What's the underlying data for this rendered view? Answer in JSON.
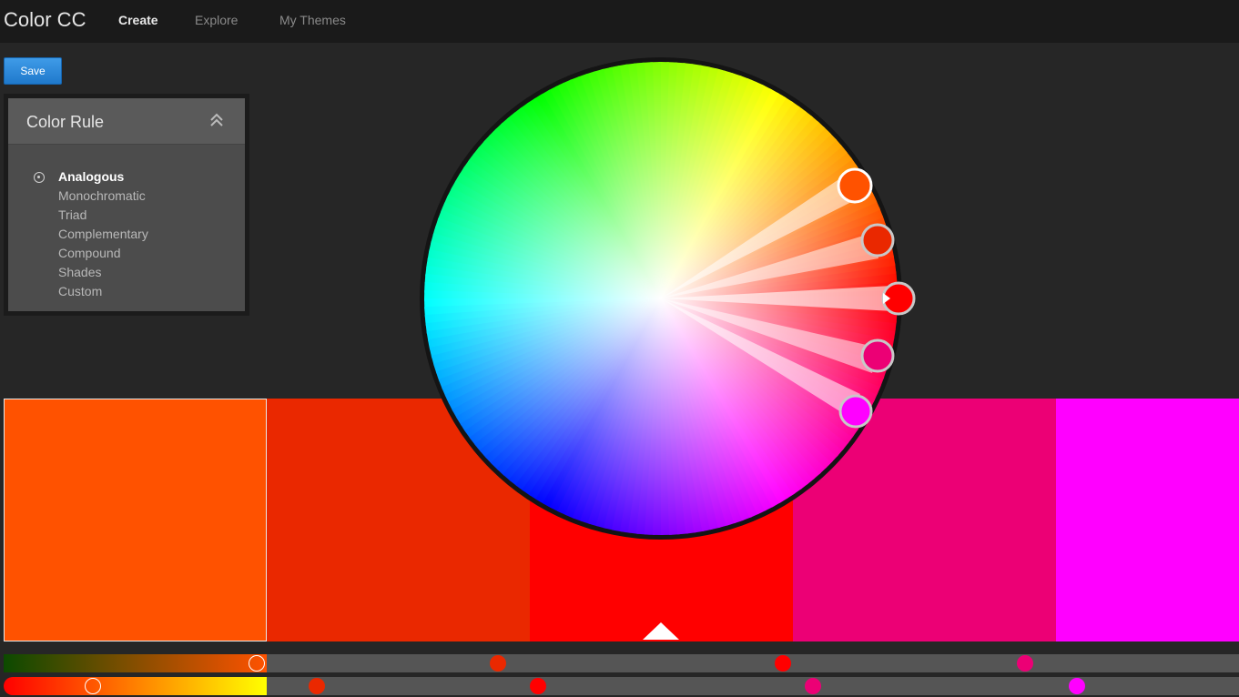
{
  "app": {
    "title": "Color CC"
  },
  "nav": {
    "tabs": [
      {
        "label": "Create",
        "active": true
      },
      {
        "label": "Explore",
        "active": false
      },
      {
        "label": "My Themes",
        "active": false
      }
    ]
  },
  "toolbar": {
    "save_label": "Save"
  },
  "color_rule": {
    "title": "Color Rule",
    "selected": "Analogous",
    "options": [
      "Analogous",
      "Monochromatic",
      "Triad",
      "Complementary",
      "Compound",
      "Shades",
      "Custom"
    ]
  },
  "theme": {
    "swatches": [
      {
        "color": "#ff5200"
      },
      {
        "color": "#ea2800"
      },
      {
        "color": "#ff0000"
      },
      {
        "color": "#ec0075"
      },
      {
        "color": "#ff00ff"
      }
    ],
    "base_index": 2
  },
  "wheel": {
    "icons": [
      "color-wheel",
      "color-handle-icon",
      "base-marker-icon"
    ]
  },
  "colors": {
    "accent": "#2a8be0",
    "background": "#262626",
    "topbar": "#1a1a1a",
    "panel": "#4c4c4c"
  }
}
